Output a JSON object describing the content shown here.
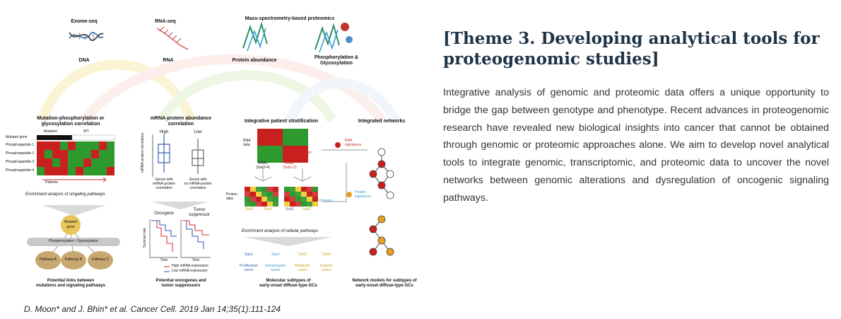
{
  "figure": {
    "top_labels": {
      "exome_seq": "Exome-seq",
      "dna": "DNA",
      "rna_seq": "RNA-seq",
      "rna": "RNA",
      "ms_proteomics": "Mass-spectrometry-based proteomics",
      "protein_abundance": "Protein abundance",
      "phospho_glyco": "Phosphorylation &",
      "glycosylation": "Glycosylation"
    },
    "panel1": {
      "title_line1": "Mutation-phosphorylation or",
      "title_line2": "glycosylation correlation",
      "mutated_gene": "Mutated gene",
      "mutation": "Mutation",
      "wt": "WT",
      "rows": [
        "Phosphopeptide 1",
        "Phosphopeptide 2",
        "Phosphopeptide 3",
        "Phosphopeptide 4"
      ],
      "patients": "Patients",
      "enrichment": "Enrichment analysis of singaling pathways",
      "node_mutated": "Mutated",
      "node_gene": "gene",
      "bar": "Phosphorylation / Glycosylation",
      "pathway_a": "Pathway A",
      "pathway_b": "Pathway B",
      "pathway_c": "Pathway C",
      "caption_line1": "Potential links between",
      "caption_line2": "mutations and signaling pathways"
    },
    "panel2": {
      "title_line1": "mRNA-protein abundance",
      "title_line2": "correlation",
      "high": "High",
      "low": "Low",
      "ylabel": "mRNA-protein correlation",
      "genes_with": "Genes with",
      "genes_with_no": "Genes with",
      "mrna_protein": "mRNA-protein",
      "no_mrna_protein": "no mRNA-protein",
      "correlation": "correlation",
      "oncogene": "Oncogene",
      "tumor": "Tumor",
      "suppressor": "suppressor",
      "survival_rate": "Survival rate",
      "time1": "Time",
      "time2": "Time",
      "legend_high": "High mRNA expression",
      "legend_low": "Low mRNA expression",
      "caption_line1": "Potential oncogenes and",
      "caption_line2": "tumor suppressors"
    },
    "panel3": {
      "title": "Integrative patient stratification",
      "rna": "RNA",
      "data": "data",
      "genes": "Genes",
      "rna1": "RNA1",
      "rna1_sub": "(Sub3-4)",
      "rna2": "RNA2",
      "rna2_sub": "(Sub1-2)",
      "protein": "Protein",
      "data2": "data",
      "sub3": "Sub3",
      "sub4": "Sub4",
      "sub1": "Sub1",
      "sub2": "Sub2",
      "proteins": "Proteins",
      "enrichment": "Enrichment analysis of cellular pathways",
      "subtypes": [
        "Sub1",
        "Sub2",
        "Sub3",
        "Sub4"
      ],
      "subtype_desc_1": [
        "Proliferative",
        "tumor"
      ],
      "subtype_desc_2": [
        "Immunogenic",
        "tumor"
      ],
      "subtype_desc_3": [
        "Metabolic",
        "tumor"
      ],
      "subtype_desc_4": [
        "Invasive",
        "tumor"
      ],
      "caption_line1": "Molecular subtypes of",
      "caption_line2": "early-onset diffuse-type GCs"
    },
    "panel4": {
      "title": "Integrated networks",
      "rna_sig1": "RNA",
      "rna_sig2": "signatures",
      "prot_sig1": "Protein",
      "prot_sig2": "signatures",
      "caption_line1": "Network models for subtypes of",
      "caption_line2": "early-onset diffuse-type GCs"
    },
    "colors": {
      "heat_red": "#c8201e",
      "heat_green": "#2e9a2e",
      "node_gold": "#e8c55a",
      "node_tan": "#c8a870"
    }
  },
  "citation": "D. Moon* and J. Bhin* et al. Cancer Cell. 2019 Jan 14;35(1):111-124",
  "theme": {
    "title": "[Theme 3. Developing analytical tools for proteogenomic studies]",
    "body": "Integrative analysis of genomic and proteomic data offers a unique opportunity to bridge the gap between genotype and phenotype. Recent advances in proteogenomic research have revealed new biological insights into cancer that cannot be obtained through genomic or proteomic approaches alone. We aim to develop novel analytical tools to integrate genomic, transcriptomic, and proteomic data to uncover the novel networks between genomic alterations and dysregulation of oncogenic signaling pathways."
  }
}
